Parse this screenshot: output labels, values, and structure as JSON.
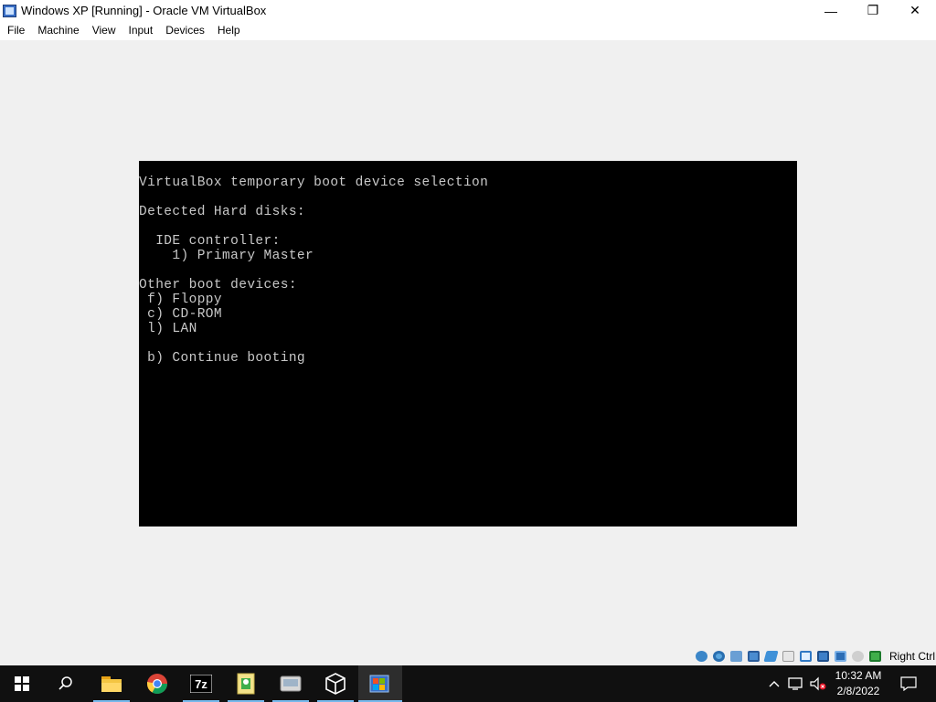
{
  "window": {
    "title": "Windows XP [Running] - Oracle VM VirtualBox",
    "minimize_glyph": "—",
    "restore_glyph": "❐",
    "close_glyph": "✕"
  },
  "menu": [
    "File",
    "Machine",
    "View",
    "Input",
    "Devices",
    "Help"
  ],
  "vm_screen": {
    "lines": [
      "VirtualBox temporary boot device selection",
      "Detected Hard disks:",
      "  IDE controller:",
      "    1) Primary Master",
      "Other boot devices:",
      " f) Floppy",
      " c) CD-ROM",
      " l) LAN",
      " b) Continue booting"
    ]
  },
  "statusbar": {
    "icons": [
      "hard-disk-icon",
      "optical-drive-icon",
      "audio-icon",
      "network-icon",
      "usb-icon",
      "shared-folders-icon",
      "display-icon",
      "video-capture-icon",
      "virtualization-icon",
      "mouse-integration-icon",
      "keyboard-icon"
    ],
    "host_key": "Right Ctrl"
  },
  "taskbar": {
    "apps": [
      "file-explorer",
      "chrome",
      "7zip",
      "green-app",
      "disk-app",
      "virtualbox",
      "windows-xp-vm"
    ],
    "clock_time": "10:32 AM",
    "clock_date": "2/8/2022"
  },
  "colors": {
    "vm_text": "#c8c8c8",
    "vm_background": "#000000",
    "taskbar": "#101010",
    "taskbar_indicator": "#76b9ed"
  }
}
